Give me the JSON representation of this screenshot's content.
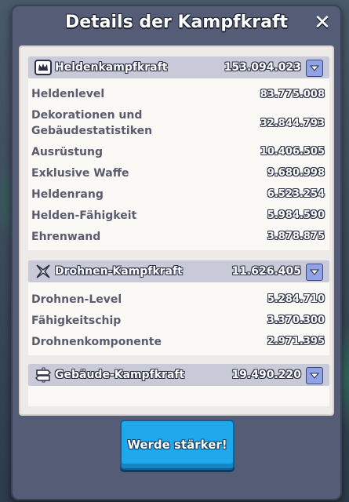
{
  "dialog": {
    "title": "Details der Kampfkraft",
    "close_icon": "close-icon"
  },
  "sections": [
    {
      "icon": "hero-crown-icon",
      "title": "Heldenkampfkraft",
      "value": "153.094.023",
      "rows": [
        {
          "label": "Heldenlevel",
          "value": "83.775.008"
        },
        {
          "label": "Dekorationen und Gebäudestatistiken",
          "value": "32.844.793"
        },
        {
          "label": "Ausrüstung",
          "value": "10.406.505"
        },
        {
          "label": "Exklusive Waffe",
          "value": "9.680.998"
        },
        {
          "label": "Heldenrang",
          "value": "6.523.254"
        },
        {
          "label": "Helden-Fähigkeit",
          "value": "5.984.590"
        },
        {
          "label": "Ehrenwand",
          "value": "3.878.875"
        }
      ]
    },
    {
      "icon": "drone-icon",
      "title": "Drohnen-Kampfkraft",
      "value": "11.626.405",
      "rows": [
        {
          "label": "Drohnen-Level",
          "value": "5.284.710"
        },
        {
          "label": "Fähigkeitschip",
          "value": "3.370.300"
        },
        {
          "label": "Drohnenkomponente",
          "value": "2.971.395"
        }
      ]
    },
    {
      "icon": "signpost-icon",
      "title": "Gebäude-Kampfkraft",
      "value": "19.490.220",
      "rows": []
    }
  ],
  "cta": {
    "label": "Werde stärker!"
  },
  "colors": {
    "modal": "#545d75",
    "header": "#c9cad8",
    "button": "#1fa9ec"
  }
}
